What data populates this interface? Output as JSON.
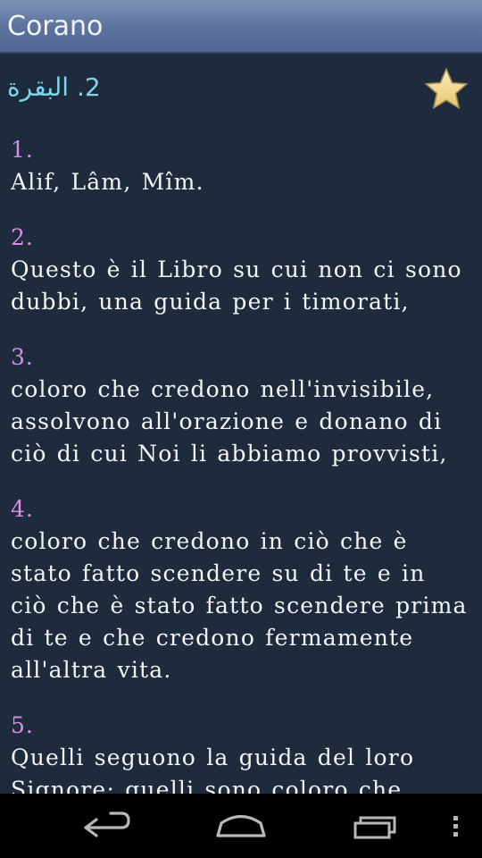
{
  "actionbar": {
    "title": "Corano"
  },
  "surah": {
    "title": "2. البقرة",
    "favorite_icon": "star-icon"
  },
  "verses": [
    {
      "num": "1.",
      "text": "Alif, Lâm, Mîm."
    },
    {
      "num": "2.",
      "text": "Questo è il Libro su cui non ci sono dubbi, una guida per i timorati,"
    },
    {
      "num": "3.",
      "text": "coloro che credono nell'invisibile, assolvono all'orazione e donano di ciò di cui Noi li abbiamo provvisti,"
    },
    {
      "num": "4.",
      "text": "coloro che credono in ciò che è stato fatto scendere su di te e in ciò che è stato fatto scendere prima di te e che credono fermamente all'altra vita."
    },
    {
      "num": "5.",
      "text": "Quelli seguono la guida del loro Signore; quelli sono coloro che"
    }
  ],
  "navbar": {
    "back_icon": "back-arrow-icon",
    "home_icon": "home-icon",
    "recents_icon": "recent-apps-icon",
    "menu_icon": "overflow-menu-icon"
  },
  "colors": {
    "background": "#1d2b3d",
    "verse_number": "#d98ce6",
    "surah_title": "#7fd3ea",
    "star": "#f3d78a"
  }
}
